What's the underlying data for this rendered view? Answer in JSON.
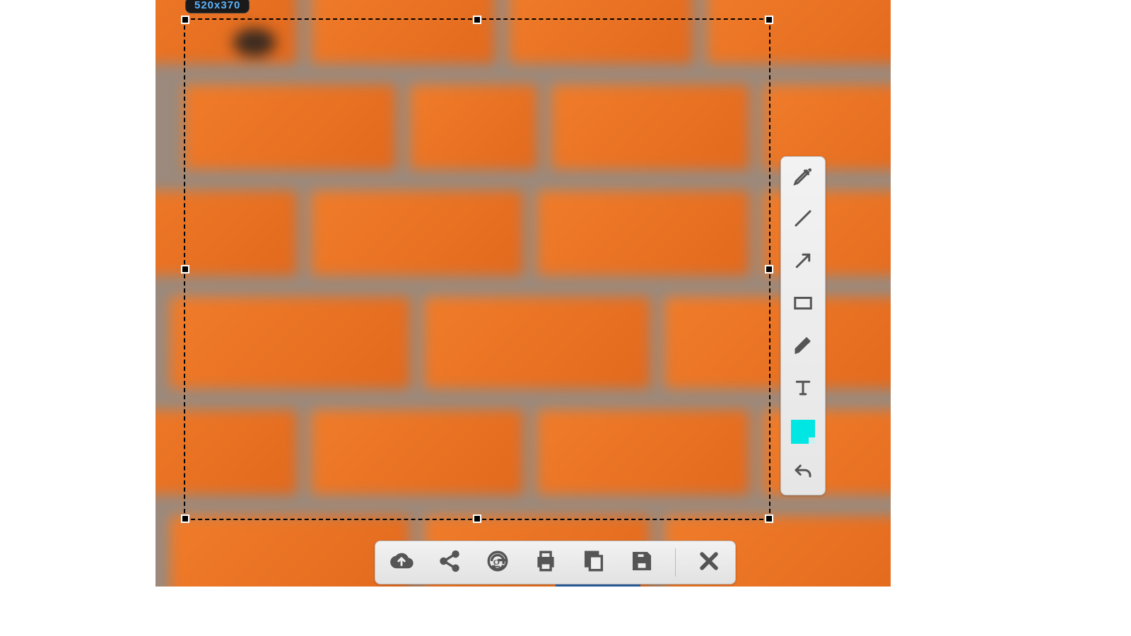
{
  "selection": {
    "size_label": "520x370"
  },
  "side_tools": {
    "pencil": "pencil-icon",
    "line": "line-icon",
    "arrow": "arrow-icon",
    "rectangle": "rectangle-icon",
    "marker": "marker-icon",
    "text": "text-icon",
    "color": "#00e6e2",
    "undo": "undo-icon"
  },
  "bottom_tools": {
    "upload": "cloud-upload-icon",
    "share": "share-icon",
    "google": "google-icon",
    "print": "print-icon",
    "copy": "copy-icon",
    "save": "save-icon",
    "close": "close-icon"
  }
}
